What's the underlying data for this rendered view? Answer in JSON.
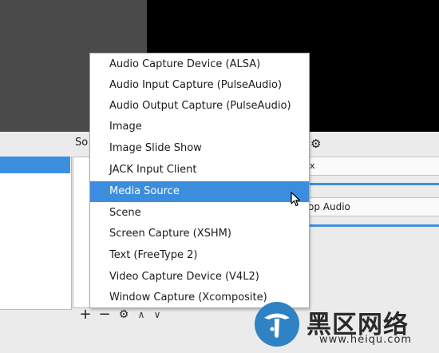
{
  "sources": {
    "title": "So"
  },
  "mixer": {
    "channel1_label": "x",
    "channel2_label": "op Audio"
  },
  "context_menu": {
    "items": [
      "Audio Capture Device (ALSA)",
      "Audio Input Capture (PulseAudio)",
      "Audio Output Capture (PulseAudio)",
      "Image",
      "Image Slide Show",
      "JACK Input Client",
      "Media Source",
      "Scene",
      "Screen Capture (XSHM)",
      "Text (FreeType 2)",
      "Video Capture Device (V4L2)",
      "Window Capture (Xcomposite)"
    ],
    "highlighted": "Media Source"
  },
  "toolbar": {
    "add_label": "+",
    "remove_label": "−",
    "settings_icon": "gear-icon",
    "up_label": "∧",
    "down_label": "∨"
  },
  "watermark": {
    "title": "黑区网络",
    "url": "www.heiqu.com"
  },
  "colors": {
    "highlight": "#3c8dde",
    "preview_left": "#4b4b4b",
    "preview_right": "#000000"
  }
}
